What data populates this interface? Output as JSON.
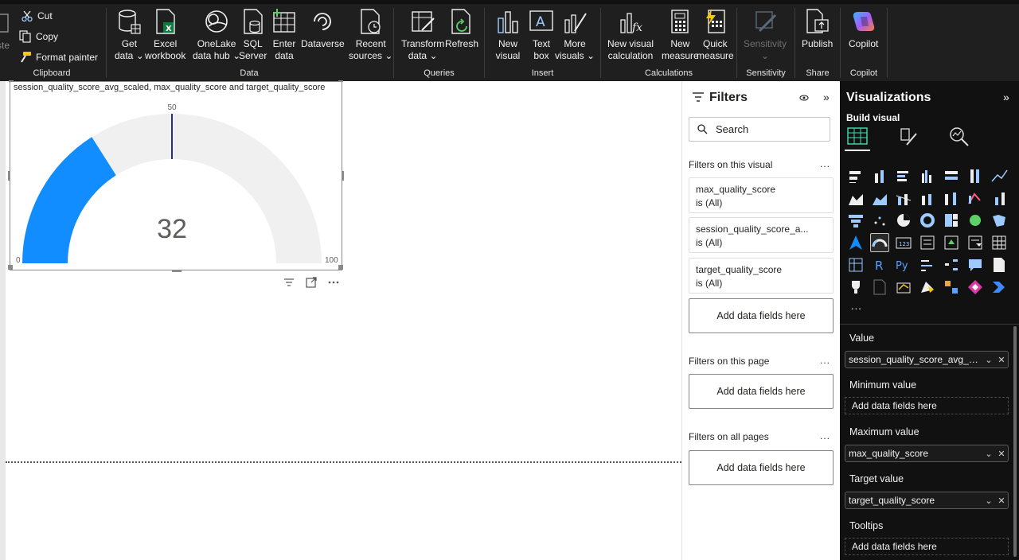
{
  "ribbon": {
    "clipboard": {
      "paste_label": "ste",
      "cut": "Cut",
      "copy": "Copy",
      "format_painter": "Format painter",
      "group": "Clipboard"
    },
    "data": {
      "get_data": [
        "Get",
        "data"
      ],
      "excel": [
        "Excel",
        "workbook"
      ],
      "onelake": [
        "OneLake",
        "data hub"
      ],
      "sql": [
        "SQL",
        "Server"
      ],
      "enter": [
        "Enter",
        "data"
      ],
      "dataverse": [
        "Dataverse",
        ""
      ],
      "recent": [
        "Recent",
        "sources"
      ],
      "group": "Data"
    },
    "queries": {
      "transform": [
        "Transform",
        "data"
      ],
      "refresh": [
        "Refresh",
        ""
      ],
      "group": "Queries"
    },
    "insert": {
      "new_visual": [
        "New",
        "visual"
      ],
      "text_box": [
        "Text",
        "box"
      ],
      "more_visuals": [
        "More",
        "visuals"
      ],
      "group": "Insert"
    },
    "calculations": {
      "new_visual_calc": [
        "New visual",
        "calculation"
      ],
      "new_measure": [
        "New",
        "measure"
      ],
      "quick_measure": [
        "Quick",
        "measure"
      ],
      "group": "Calculations"
    },
    "sensitivity": {
      "label": "Sensitivity",
      "group": "Sensitivity"
    },
    "share": {
      "publish": "Publish",
      "group": "Share"
    },
    "copilot": {
      "label": "Copilot",
      "group": "Copilot"
    }
  },
  "visual": {
    "title": "session_quality_score_avg_scaled, max_quality_score and target_quality_score",
    "gauge": {
      "min": 0,
      "max": 100,
      "value": 32,
      "target": 50,
      "value_label": "32",
      "min_label": "0",
      "max_label": "100",
      "target_label": "50",
      "fill_color": "#118DFF",
      "track_color": "#F0F0F0",
      "target_color": "#2B2F7E"
    }
  },
  "filters": {
    "title": "Filters",
    "search_placeholder": "Search",
    "on_visual": "Filters on this visual",
    "cards": [
      {
        "name": "max_quality_score",
        "state": "is (All)"
      },
      {
        "name": "session_quality_score_a...",
        "state": "is (All)"
      },
      {
        "name": "target_quality_score",
        "state": "is (All)"
      }
    ],
    "add_fields": "Add data fields here",
    "on_page": "Filters on this page",
    "on_all_pages": "Filters on all pages",
    "more": "..."
  },
  "visualizations": {
    "title": "Visualizations",
    "build_visual": "Build visual",
    "more": "...",
    "wells": {
      "value_label": "Value",
      "value_field": "session_quality_score_avg_scal...",
      "min_label": "Minimum value",
      "max_label": "Maximum value",
      "max_field": "max_quality_score",
      "target_label": "Target value",
      "target_field": "target_quality_score",
      "tooltips_label": "Tooltips",
      "add_fields": "Add data fields here"
    }
  }
}
